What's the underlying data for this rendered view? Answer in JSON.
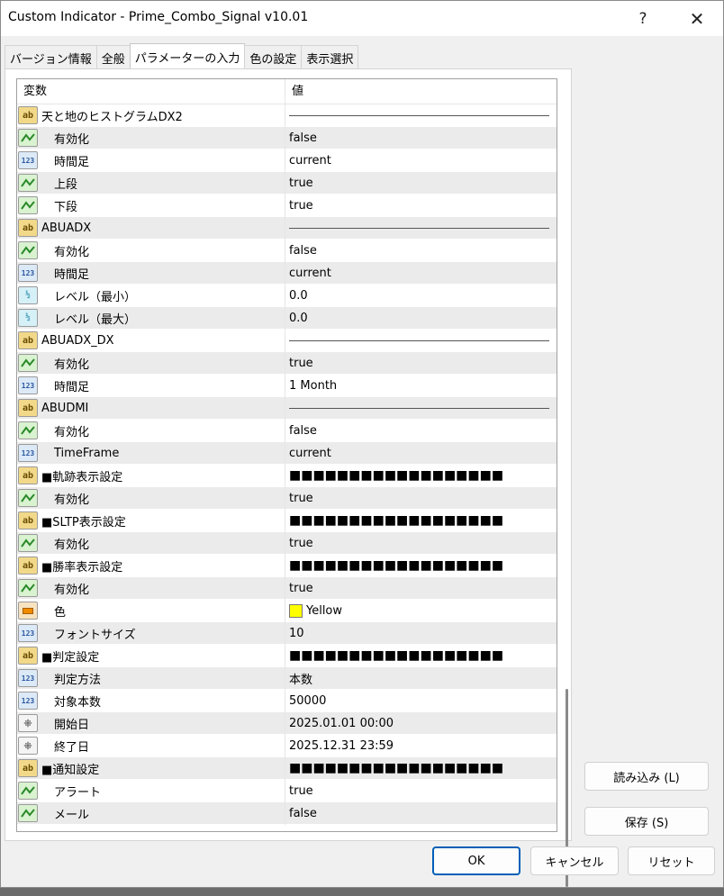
{
  "window": {
    "title": "Custom Indicator - Prime_Combo_Signal v10.01",
    "help_glyph": "?",
    "close_glyph": "✕"
  },
  "tabs": [
    {
      "label": "バージョン情報",
      "active": false
    },
    {
      "label": "全般",
      "active": false
    },
    {
      "label": "パラメーターの入力",
      "active": true
    },
    {
      "label": "色の設定",
      "active": false
    },
    {
      "label": "表示選択",
      "active": false
    }
  ],
  "columns": {
    "variable": "変数",
    "value": "値"
  },
  "rows": [
    {
      "type": "string",
      "name": "天と地のヒストグラムDX2",
      "value": "",
      "sep": true,
      "indent": false
    },
    {
      "type": "bool",
      "name": "有効化",
      "value": "false",
      "indent": true
    },
    {
      "type": "int",
      "name": "時間足",
      "value": "current",
      "indent": true
    },
    {
      "type": "bool",
      "name": "上段",
      "value": "true",
      "indent": true
    },
    {
      "type": "bool",
      "name": "下段",
      "value": "true",
      "indent": true
    },
    {
      "type": "string",
      "name": "ABUADX",
      "value": "",
      "sep": true,
      "indent": false
    },
    {
      "type": "bool",
      "name": "有効化",
      "value": "false",
      "indent": true
    },
    {
      "type": "int",
      "name": "時間足",
      "value": "current",
      "indent": true
    },
    {
      "type": "double",
      "name": "レベル（最小）",
      "value": "0.0",
      "indent": true
    },
    {
      "type": "double",
      "name": "レベル（最大）",
      "value": "0.0",
      "indent": true
    },
    {
      "type": "string",
      "name": "ABUADX_DX",
      "value": "",
      "sep": true,
      "indent": false
    },
    {
      "type": "bool",
      "name": "有効化",
      "value": "true",
      "indent": true
    },
    {
      "type": "int",
      "name": "時間足",
      "value": "1 Month",
      "indent": true
    },
    {
      "type": "string",
      "name": "ABUDMI",
      "value": "",
      "sep": true,
      "indent": false
    },
    {
      "type": "bool",
      "name": "有効化",
      "value": "false",
      "indent": true
    },
    {
      "type": "int",
      "name": "TimeFrame",
      "value": "current",
      "indent": true
    },
    {
      "type": "string",
      "name": "■軌跡表示設定",
      "value": "■■■■■■■■■■■■■■■■■■",
      "indent": false
    },
    {
      "type": "bool",
      "name": "有効化",
      "value": "true",
      "indent": true
    },
    {
      "type": "string",
      "name": "■SLTP表示設定",
      "value": "■■■■■■■■■■■■■■■■■■",
      "indent": false
    },
    {
      "type": "bool",
      "name": "有効化",
      "value": "true",
      "indent": true
    },
    {
      "type": "string",
      "name": "■勝率表示設定",
      "value": "■■■■■■■■■■■■■■■■■■",
      "indent": false
    },
    {
      "type": "bool",
      "name": "有効化",
      "value": "true",
      "indent": true
    },
    {
      "type": "color",
      "name": "色",
      "value": "Yellow",
      "swatch": "#ffff00",
      "indent": true
    },
    {
      "type": "int",
      "name": "フォントサイズ",
      "value": "10",
      "indent": true
    },
    {
      "type": "string",
      "name": "■判定設定",
      "value": "■■■■■■■■■■■■■■■■■■",
      "indent": false
    },
    {
      "type": "int",
      "name": "判定方法",
      "value": "本数",
      "indent": true
    },
    {
      "type": "int",
      "name": "対象本数",
      "value": "50000",
      "indent": true
    },
    {
      "type": "datetime",
      "name": "開始日",
      "value": "2025.01.01 00:00",
      "indent": true
    },
    {
      "type": "datetime",
      "name": "終了日",
      "value": "2025.12.31 23:59",
      "indent": true
    },
    {
      "type": "string",
      "name": "■通知設定",
      "value": "■■■■■■■■■■■■■■■■■■",
      "indent": false
    },
    {
      "type": "bool",
      "name": "アラート",
      "value": "true",
      "indent": true
    },
    {
      "type": "bool",
      "name": "メール",
      "value": "false",
      "indent": true
    }
  ],
  "icons": {
    "string": {
      "name": "string-type-icon",
      "glyph": "ab"
    },
    "bool": {
      "name": "bool-type-icon",
      "glyph": ""
    },
    "int": {
      "name": "integer-type-icon",
      "glyph": "123"
    },
    "double": {
      "name": "double-type-icon",
      "glyph": "½"
    },
    "color": {
      "name": "color-type-icon",
      "glyph": ""
    },
    "datetime": {
      "name": "datetime-type-icon",
      "glyph": "⁜"
    }
  },
  "buttons": {
    "load": "読み込み (L)",
    "save": "保存 (S)",
    "ok": "OK",
    "cancel": "キャンセル",
    "reset": "リセット"
  }
}
